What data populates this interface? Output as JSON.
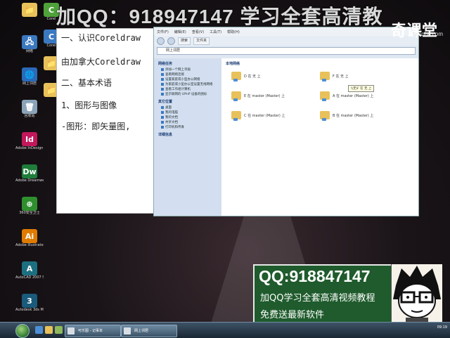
{
  "watermark": {
    "text": "加QQ：918947147 学习全套高清教",
    "top_right": "奇课堂",
    "url": "tv.sohu.com"
  },
  "desktop_icons": [
    {
      "label": "",
      "color": "#e8c15a",
      "glyph": "📁"
    },
    {
      "label": "网络",
      "color": "#3a78c0",
      "glyph": "🖧"
    },
    {
      "label": "网上邻居",
      "color": "#2a6ab8",
      "glyph": "🌐"
    },
    {
      "label": "回收站",
      "color": "#8aa3b8",
      "glyph": "🗑"
    },
    {
      "label": "Adobe InDesign CS5",
      "color": "#c2185b",
      "glyph": "Id"
    },
    {
      "label": "Adobe Dreamweaver",
      "color": "#1e7d3a",
      "glyph": "Dw"
    },
    {
      "label": "360安全卫士",
      "color": "#2f8f2f",
      "glyph": "⊕"
    },
    {
      "label": "Adobe Illustrator CS5",
      "color": "#e07b00",
      "glyph": "Ai"
    },
    {
      "label": "AutoCAD 2007 Simplified",
      "color": "#1c6f80",
      "glyph": "A"
    },
    {
      "label": "Autodesk 3ds Max 9 32 bit",
      "color": "#1a5a7a",
      "glyph": "3"
    }
  ],
  "col2_icons": [
    {
      "label": "Corel",
      "color": "#4fa13a",
      "glyph": "C"
    },
    {
      "label": "Corel",
      "color": "#3a78c0",
      "glyph": "C"
    },
    {
      "label": "",
      "color": "#e8c15a",
      "glyph": "📁"
    },
    {
      "label": "",
      "color": "#e8c15a",
      "glyph": "📁"
    }
  ],
  "document": {
    "lines": [
      "一、认识Coreldraw",
      "由加拿大Coreldraw",
      "二、基本术语",
      "1、图形与图像",
      "-图形：即矢量图,"
    ]
  },
  "explorer": {
    "menu": [
      "文件(F)",
      "编辑(E)",
      "查看(V)",
      "工具(T)",
      "帮助(H)"
    ],
    "toolbar": [
      "搜索",
      "文件夹"
    ],
    "address": "网上邻居",
    "side_sections": [
      {
        "heading": "网络任务",
        "items": [
          "添加一个网上邻居",
          "查看网络连接",
          "设置家庭或小型办公网络",
          "为家庭或小型办公室设置无线网络",
          "查看工作组计算机",
          "显示联网的 UPnP 设备的图标"
        ]
      },
      {
        "heading": "其它位置",
        "items": [
          "桌面",
          "我的电脑",
          "我的文档",
          "共享文档",
          "打印机和传真"
        ]
      },
      {
        "heading": "详细信息",
        "items": []
      }
    ],
    "main_heading": "本地网络",
    "shares": [
      {
        "label": "D 在 无 上"
      },
      {
        "label": "F 在 无 上"
      },
      {
        "label": "E 在 master (Master) 上"
      },
      {
        "label": "A 在 master (Master) 上"
      },
      {
        "label": "C 在 master (Master) 上"
      },
      {
        "label": "B 在 master (Master) 上"
      }
    ],
    "tooltip": "\\\\无\\F 在 无 上"
  },
  "promo": {
    "qq": "QQ:918847147",
    "line2": "加QQ学习全套高清视频教程",
    "line3": "免费送最新软件"
  },
  "taskbar": {
    "buttons": [
      "可乐图 - 记事本",
      "网上邻居"
    ],
    "clock_time": "09:19",
    "clock_date": ""
  }
}
